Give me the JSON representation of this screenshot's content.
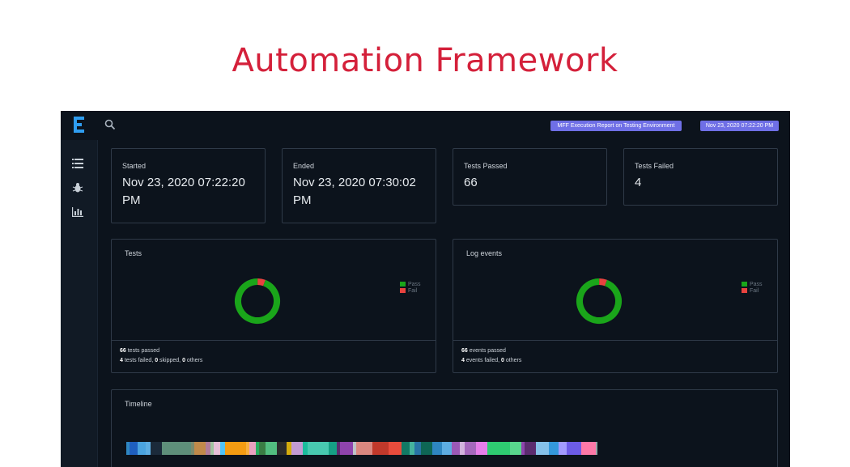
{
  "heading": "Automation Framework",
  "topbar": {
    "report_tag": "MFF Execution Report on Testing Environment",
    "date_tag": "Nov 23, 2020 07:22:20 PM"
  },
  "stats": {
    "started": {
      "label": "Started",
      "value": "Nov 23, 2020 07:22:20 PM"
    },
    "ended": {
      "label": "Ended",
      "value": "Nov 23, 2020 07:30:02 PM"
    },
    "passed": {
      "label": "Tests Passed",
      "value": "66"
    },
    "failed": {
      "label": "Tests Failed",
      "value": "4"
    }
  },
  "tests_panel": {
    "title": "Tests",
    "legend": [
      "Pass",
      "Fail"
    ],
    "pass_count": 66,
    "fail_count": 4,
    "line1_value": "66",
    "line1_text": " tests passed",
    "line2_a": "4",
    "line2_b": " tests failed, ",
    "line2_c": "0",
    "line2_d": " skipped, ",
    "line2_e": "0",
    "line2_f": " others"
  },
  "log_panel": {
    "title": "Log events",
    "legend": [
      "Pass",
      "Fail"
    ],
    "pass_count": 66,
    "fail_count": 4,
    "line1_value": "66",
    "line1_text": " events passed",
    "line2_a": "4",
    "line2_b": " events failed, ",
    "line2_c": "0",
    "line2_d": " others"
  },
  "timeline": {
    "title": "Timeline",
    "colors": [
      "#2e86c1",
      "#1f5fbf",
      "#4aa3df",
      "#5dade2",
      "#1b2a3a",
      "#5e8f7a",
      "#7a8b6f",
      "#c08a4a",
      "#b07d9a",
      "#a0c4a0",
      "#e6c0d8",
      "#4fc3f7",
      "#f39c12",
      "#f5b041",
      "#e8a0c0",
      "#27ae60",
      "#3a7d44",
      "#52be80",
      "#2b2b2b",
      "#d4ac0d",
      "#c39bd3",
      "#1abc9c",
      "#48c9b0",
      "#16a085",
      "#5b2c6f",
      "#8e44ad",
      "#bdc3c7",
      "#d98880",
      "#c0392b",
      "#e74c3c",
      "#117a65",
      "#45b39d",
      "#2874a6",
      "#0e6655",
      "#2e86c1",
      "#5dade2",
      "#9b59b6",
      "#d2b4de",
      "#a569bd",
      "#e67eea",
      "#2ecc71",
      "#58d68d",
      "#8e44ad",
      "#5b2c6f",
      "#85c1e9",
      "#3498db",
      "#a29bfe",
      "#6c5ce7",
      "#fd79a8",
      "#95a5a6"
    ],
    "widths": [
      4,
      10,
      10,
      6,
      14,
      36,
      4,
      14,
      6,
      4,
      8,
      6,
      26,
      4,
      8,
      4,
      8,
      14,
      12,
      6,
      14,
      6,
      26,
      10,
      4,
      16,
      4,
      20,
      20,
      16,
      10,
      6,
      8,
      14,
      12,
      12,
      10,
      6,
      14,
      14,
      28,
      14,
      4,
      14,
      16,
      12,
      10,
      18,
      18,
      2
    ],
    "accent": "#f04a5a"
  },
  "colors": {
    "pass": "#1aa51a",
    "fail": "#e8433f",
    "tag": "#6f6fe6"
  },
  "icons": {
    "search": "search-icon",
    "list": "list-icon",
    "bug": "bug-icon",
    "chart": "bar-chart-icon",
    "logo": "logo-icon"
  }
}
